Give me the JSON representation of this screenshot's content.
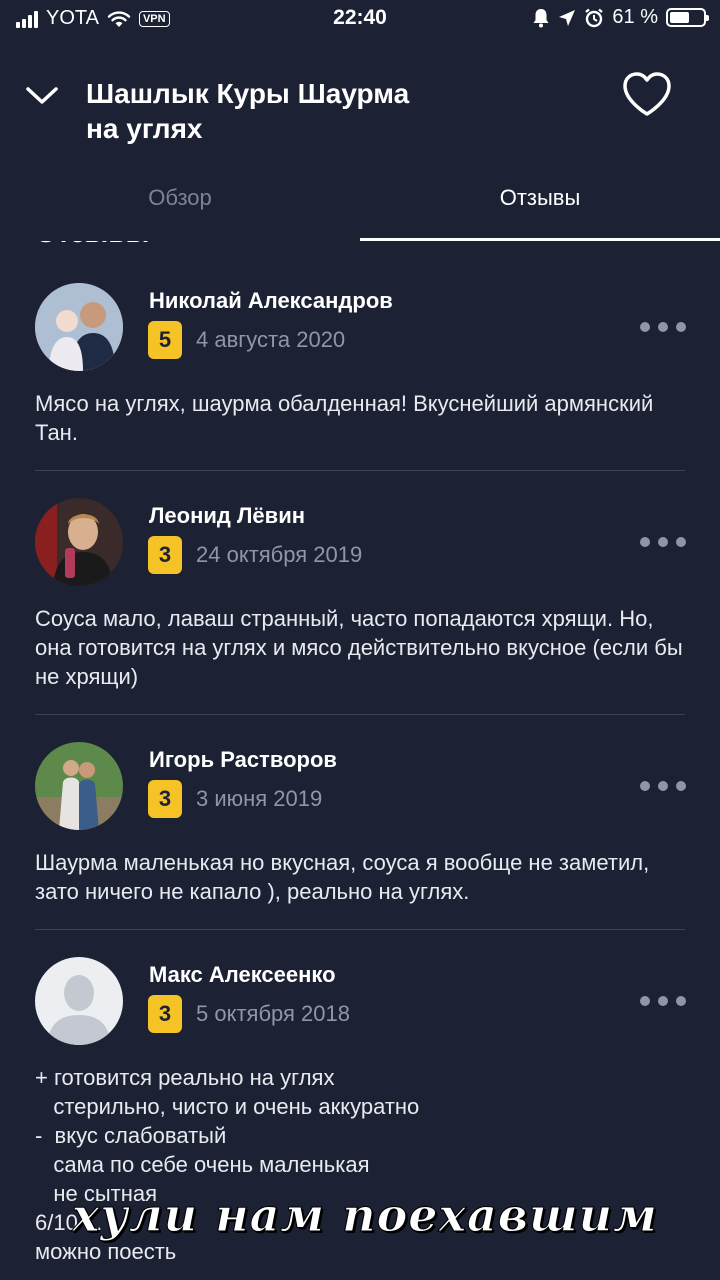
{
  "status_bar": {
    "carrier": "YOTA",
    "vpn_label": "VPN",
    "time": "22:40",
    "battery_text": "61 %",
    "battery_level": 0.61
  },
  "header": {
    "title_line1": "Шашлык Куры Шаурма",
    "title_line2": "на углях",
    "back_icon": "chevron-down-icon",
    "favorite_icon": "heart-outline-icon"
  },
  "tabs": {
    "overview": "Обзор",
    "reviews": "Отзывы",
    "active": "reviews"
  },
  "section_title": "Отзывы",
  "reviews": [
    {
      "name": "Николай Александров",
      "rating": "5",
      "date": "4 августа 2020",
      "text": "Мясо на углях, шаурма обалденная! Вкуснейший армянский Тан."
    },
    {
      "name": "Леонид Лёвин",
      "rating": "3",
      "date": "24 октября 2019",
      "text": "Соуса мало, лаваш странный, часто попадаются хрящи. Но, она готовится на углях и мясо действительно вкусное (если бы не хрящи)"
    },
    {
      "name": "Игорь Растворов",
      "rating": "3",
      "date": "3 июня 2019",
      "text": "Шаурма маленькая но вкусная, соуса я вообще не заметил, зато ничего не капало ), реально на углях."
    },
    {
      "name": "Макс Алексеенко",
      "rating": "3",
      "date": "5 октября 2018",
      "text": "+ готовится реально на углях\n   стерильно, чисто и очень аккуратно\n-  вкус слабоватый\n   сама по себе очень маленькая\n   не сытная\n6/10 ...\nможно поесть"
    }
  ],
  "watermark": "хули нам поехавшим",
  "colors": {
    "background": "#1c2233",
    "rating_badge": "#f6c326",
    "muted_text": "#9096a6",
    "divider": "#3a4153"
  }
}
